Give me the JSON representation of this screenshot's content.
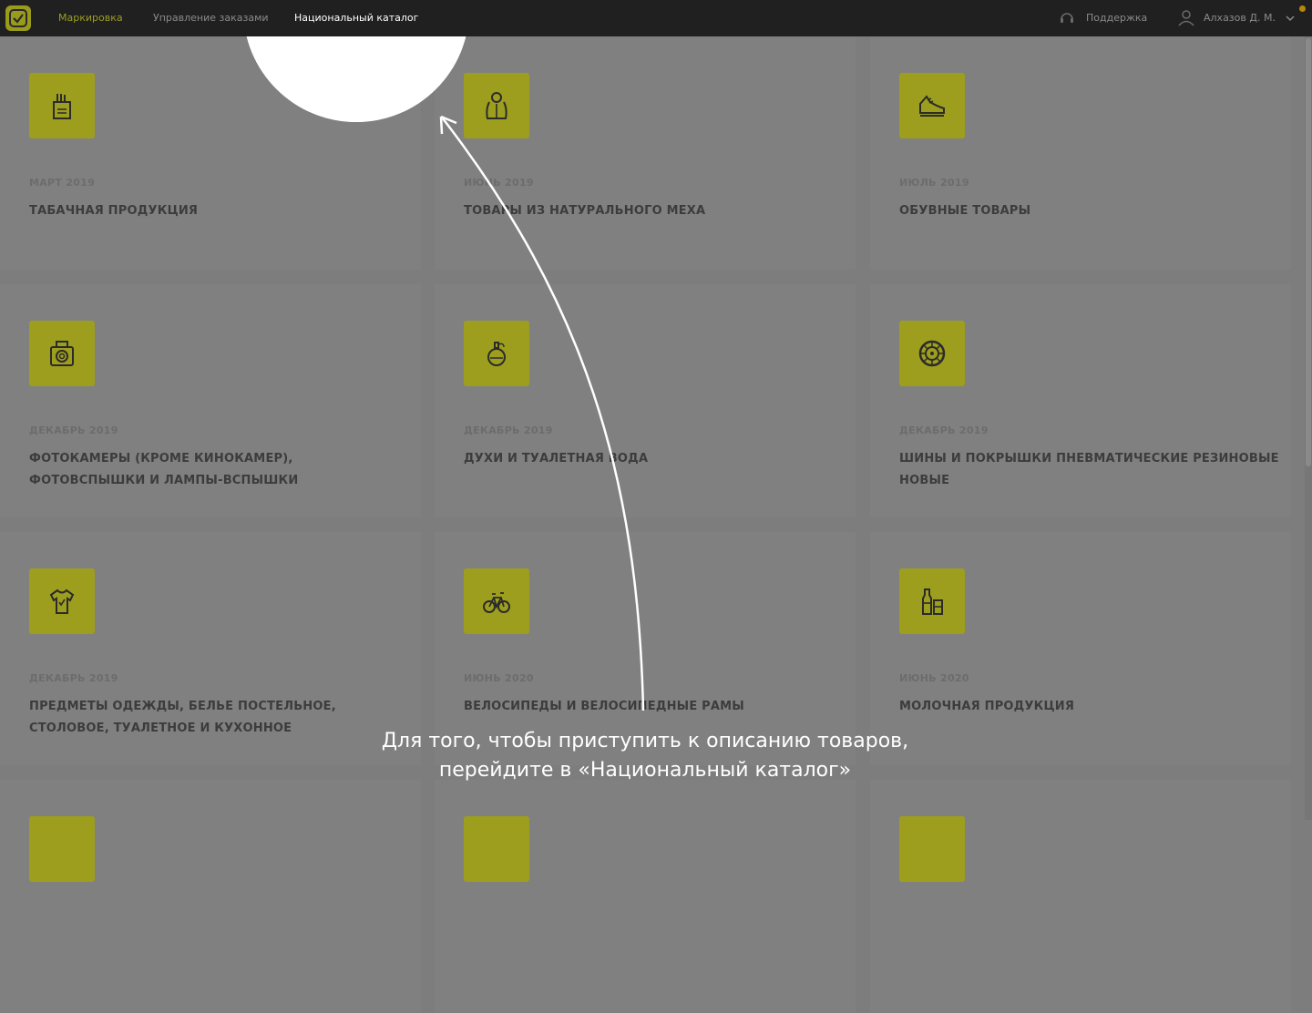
{
  "header": {
    "nav": [
      {
        "label": "Маркировка",
        "state": "active"
      },
      {
        "label": "Управление заказами",
        "state": "normal"
      },
      {
        "label": "Национальный каталог",
        "state": "current"
      }
    ],
    "support_label": "Поддержка",
    "user_name": "Алхазов Д. М."
  },
  "cards": [
    {
      "date": "МАРТ 2019",
      "title": "ТАБАЧНАЯ ПРОДУКЦИЯ",
      "icon": "tobacco-icon"
    },
    {
      "date": "ИЮНЬ 2019",
      "title": "ТОВАРЫ ИЗ НАТУРАЛЬНОГО МЕХА",
      "icon": "fur-coat-icon"
    },
    {
      "date": "ИЮЛЬ 2019",
      "title": "ОБУВНЫЕ ТОВАРЫ",
      "icon": "shoe-icon"
    },
    {
      "date": "ДЕКАБРЬ 2019",
      "title": "ФОТОКАМЕРЫ (КРОМЕ КИНОКАМЕР), ФОТОВСПЫШКИ И ЛАМПЫ-ВСПЫШКИ",
      "icon": "camera-icon"
    },
    {
      "date": "ДЕКАБРЬ 2019",
      "title": "ДУХИ И ТУАЛЕТНАЯ ВОДА",
      "icon": "perfume-icon"
    },
    {
      "date": "ДЕКАБРЬ 2019",
      "title": "ШИНЫ И ПОКРЫШКИ ПНЕВМАТИЧЕСКИЕ РЕЗИНОВЫЕ НОВЫЕ",
      "icon": "tire-icon"
    },
    {
      "date": "ДЕКАБРЬ 2019",
      "title": "ПРЕДМЕТЫ ОДЕЖДЫ, БЕЛЬЕ ПОСТЕЛЬНОЕ, СТОЛОВОЕ, ТУАЛЕТНОЕ И КУХОННОЕ",
      "icon": "clothing-icon"
    },
    {
      "date": "ИЮНЬ 2020",
      "title": "ВЕЛОСИПЕДЫ И ВЕЛОСИПЕДНЫЕ РАМЫ",
      "icon": "bicycle-icon"
    },
    {
      "date": "ИЮНЬ 2020",
      "title": "МОЛОЧНАЯ ПРОДУКЦИЯ",
      "icon": "dairy-icon"
    }
  ],
  "hint": {
    "line1": "Для того, чтобы приступить к описанию товаров,",
    "line2": "перейдите в «Национальный каталог»"
  },
  "colors": {
    "accent": "#9e9e1e",
    "overlay": "#7d7d7d",
    "header": "#202020"
  }
}
